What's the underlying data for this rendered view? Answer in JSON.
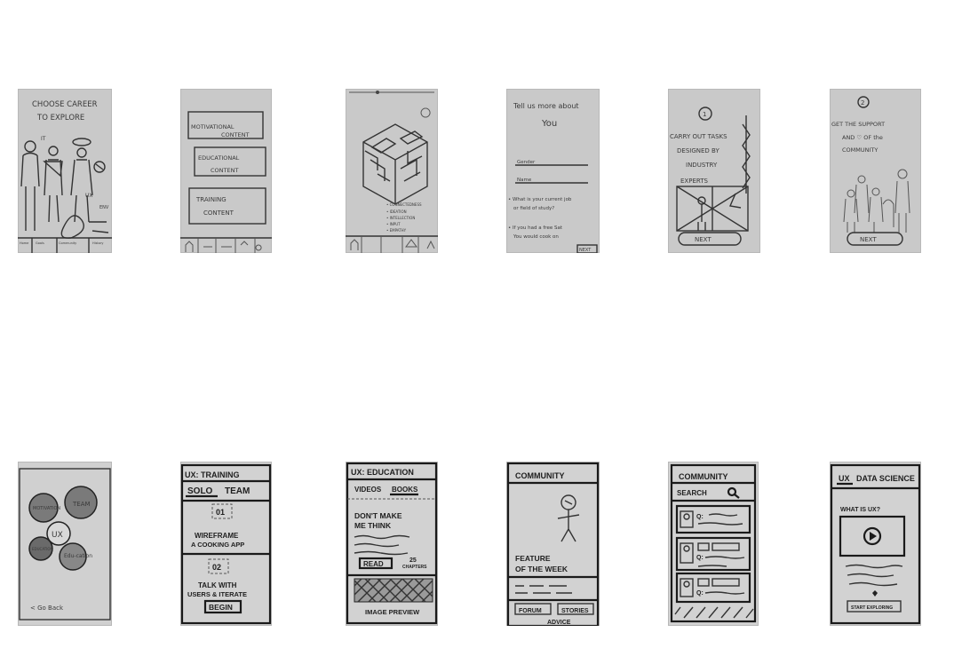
{
  "s1": {
    "title1": "CHOOSE CAREER",
    "title2": "TO EXPLORE",
    "tag1": "IT",
    "tag2": "UX",
    "tag3": "ENV",
    "tab1": "Home",
    "tab2": "Goals",
    "tab3": "Community",
    "tab4": "History"
  },
  "s2": {
    "card1a": "MOTIVATIONAL",
    "card1b": "CONTENT",
    "card2a": "EDUCATIONAL",
    "card2b": "CONTENT",
    "card3a": "TRAINING",
    "card3b": "CONTENT"
  },
  "s3": {
    "list1": "• CONNECTEDNESS",
    "list2": "• IDEATION",
    "list3": "• INTELLECTION",
    "list4": "• INPUT",
    "list5": "• EMPATHY"
  },
  "s4": {
    "title1": "Tell us more about",
    "title2": "You",
    "field1": "Gender",
    "field2": "Name",
    "q1a": "• What is your current job",
    "q1b": "or field of study?",
    "q2a": "• If you had a free Sat",
    "q2b": "You would cook on",
    "next": "NEXT"
  },
  "s5": {
    "step": "1",
    "line1": "CARRY OUT TASKS",
    "line2": "DESIGNED BY",
    "line3": "INDUSTRY",
    "line4": "EXPERTS",
    "next": "NEXT"
  },
  "s6": {
    "step": "2",
    "line1": "GET THE SUPPORT",
    "line2": "AND ♡ OF the",
    "line3": "COMMUNITY",
    "next": "NEXT"
  },
  "s7": {
    "c1": "MOTIVATION",
    "c2": "TEAM",
    "c3": "UX",
    "c4": "EDUCATION",
    "c5": "Edu-cation",
    "back": "< Go Back"
  },
  "s8": {
    "header": "UX: TRAINING",
    "tab1": "SOLO",
    "tab2": "TEAM",
    "n1": "01",
    "t1a": "WIREFRAME",
    "t1b": "A COOKING APP",
    "n2": "02",
    "t2a": "TALK WITH",
    "t2b": "USERS & ITERATE",
    "begin": "BEGIN"
  },
  "s9": {
    "header": "UX: EDUCATION",
    "tab1": "VIDEOS",
    "tab2": "BOOKS",
    "book1": "DON'T MAKE",
    "book2": "ME THINK",
    "read": "READ",
    "count": "25",
    "chapters": "CHAPTERS",
    "preview": "IMAGE PREVIEW"
  },
  "s10": {
    "header": "COMMUNITY",
    "feat1": "FEATURE",
    "feat2": "OF THE WEEK",
    "forum": "FORUM",
    "stories": "STORIES",
    "advice": "ADVICE"
  },
  "s11": {
    "header": "COMMUNITY",
    "search": "SEARCH",
    "q": "Q:"
  },
  "s12": {
    "header1": "UX",
    "header2": "DATA SCIENCE",
    "question": "WHAT IS UX?",
    "footer": "START EXPLORING"
  }
}
